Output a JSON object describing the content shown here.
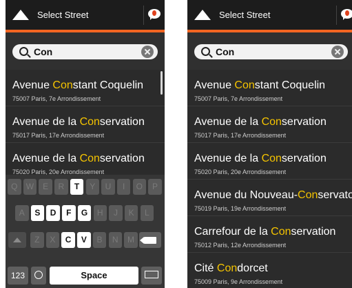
{
  "header": {
    "title": "Select Street",
    "back_icon": "navigation-arrow-icon",
    "message_icon": "chat-bubble-icon"
  },
  "search": {
    "query": "Con",
    "search_icon": "search-icon",
    "clear_icon": "clear-icon"
  },
  "results_left": [
    {
      "pre": "Avenue ",
      "hl": "Con",
      "post": "stant Coquelin",
      "addr": "75007 Paris, 7e Arrondissement"
    },
    {
      "pre": "Avenue de la ",
      "hl": "Con",
      "post": "servation",
      "addr": "75017 Paris, 17e Arrondissement"
    },
    {
      "pre": "Avenue de la ",
      "hl": "Con",
      "post": "servation",
      "addr": "75020 Paris, 20e Arrondissement"
    }
  ],
  "results_right": [
    {
      "pre": "Avenue ",
      "hl": "Con",
      "post": "stant Coquelin",
      "addr": "75007 Paris, 7e Arrondissement"
    },
    {
      "pre": "Avenue de la ",
      "hl": "Con",
      "post": "servation",
      "addr": "75017 Paris, 17e Arrondissement"
    },
    {
      "pre": "Avenue de la ",
      "hl": "Con",
      "post": "servation",
      "addr": "75020 Paris, 20e Arrondissement"
    },
    {
      "pre": "Avenue du Nouveau-",
      "hl": "Con",
      "post": "servatoire",
      "addr": "75019 Paris, 19e Arrondissement"
    },
    {
      "pre": "Carrefour de la ",
      "hl": "Con",
      "post": "servation",
      "addr": "75012 Paris, 12e Arrondissement"
    },
    {
      "pre": "Cité ",
      "hl": "Con",
      "post": "dorcet",
      "addr": "75009 Paris, 9e Arrondissement"
    }
  ],
  "keyboard": {
    "row1": [
      "Q",
      "W",
      "E",
      "R",
      "T",
      "Y",
      "U",
      "I",
      "O",
      "P"
    ],
    "row2": [
      "A",
      "S",
      "D",
      "F",
      "G",
      "H",
      "J",
      "K",
      "L"
    ],
    "row3": [
      "Z",
      "X",
      "C",
      "V",
      "B",
      "N",
      "M"
    ],
    "enabled": [
      "T",
      "S",
      "D",
      "F",
      "G",
      "C",
      "V"
    ],
    "numbers_label": "123",
    "space_label": "Space",
    "icons": {
      "shift": "shift-icon",
      "backspace": "backspace-icon",
      "globe": "globe-icon",
      "hide": "keyboard-hide-icon"
    }
  },
  "colors": {
    "accent": "#f26522",
    "highlight": "#f5c400",
    "background": "#2b2b2b",
    "header": "#1c1c1c"
  }
}
